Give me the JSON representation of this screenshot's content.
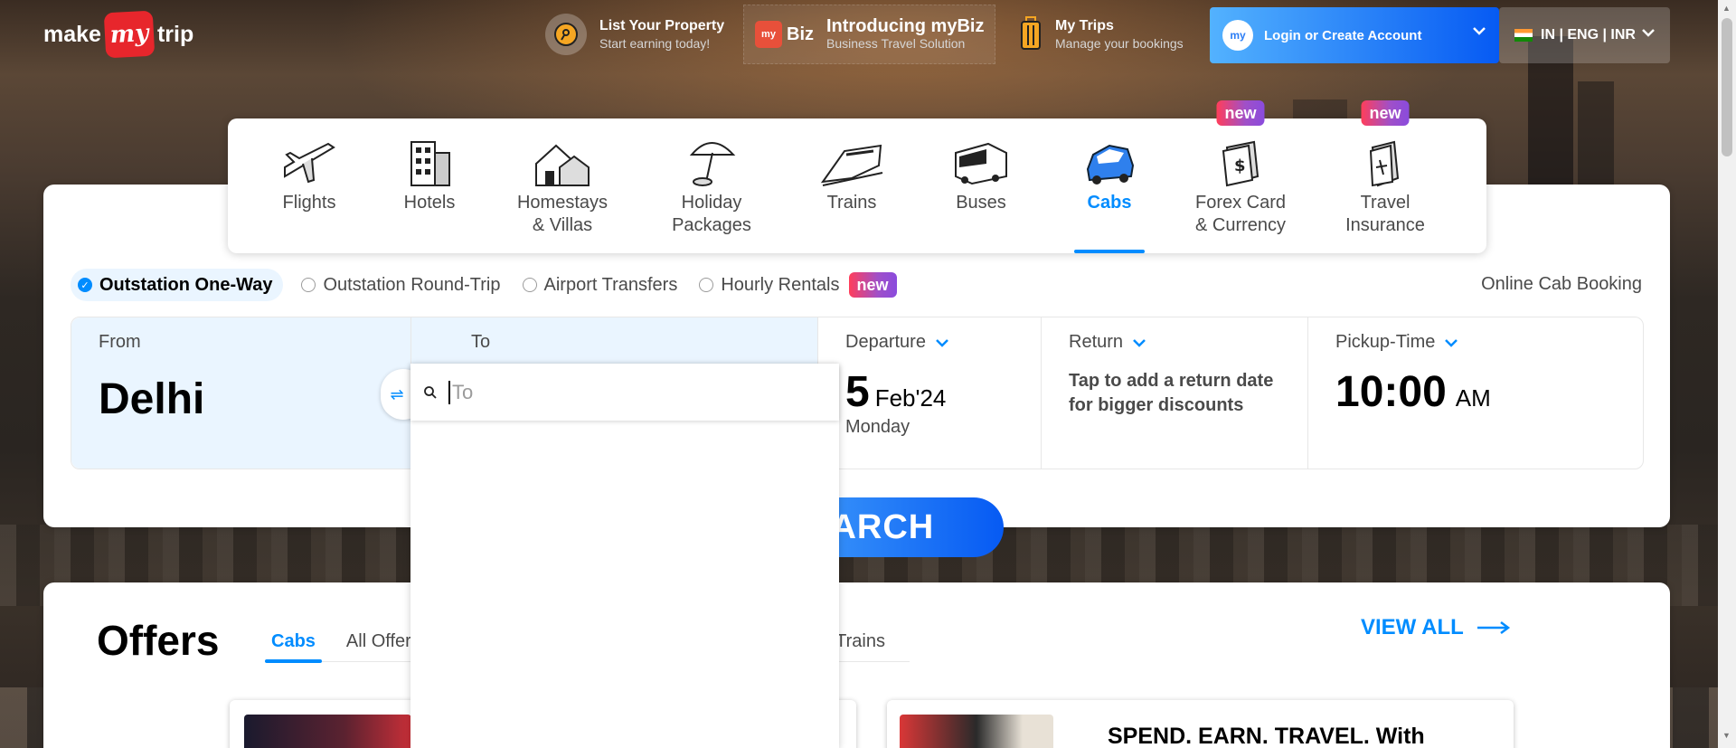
{
  "colors": {
    "accent": "#008cff",
    "brand_red": "#e7262c",
    "new_tag": "#a050c8"
  },
  "header": {
    "logo": {
      "left": "make",
      "mid": "my",
      "right": "trip"
    },
    "list_property": {
      "title": "List Your Property",
      "subtitle": "Start earning today!",
      "icon": "home-key-icon"
    },
    "mybiz": {
      "logo": "Biz",
      "title": "Introducing myBiz",
      "subtitle": "Business Travel Solution",
      "icon": "briefcase-icon"
    },
    "my_trips": {
      "title": "My Trips",
      "subtitle": "Manage your bookings",
      "icon": "suitcase-icon"
    },
    "login": {
      "label": "Login or Create Account",
      "avatar": "my"
    },
    "locale": {
      "label": "IN | ENG | INR"
    }
  },
  "nav": {
    "items": [
      {
        "label1": "Flights",
        "label2": "",
        "icon": "plane-icon",
        "new": false,
        "active": false
      },
      {
        "label1": "Hotels",
        "label2": "",
        "icon": "hotel-icon",
        "new": false,
        "active": false
      },
      {
        "label1": "Homestays",
        "label2": "& Villas",
        "icon": "homestay-icon",
        "new": false,
        "active": false
      },
      {
        "label1": "Holiday",
        "label2": "Packages",
        "icon": "umbrella-icon",
        "new": false,
        "active": false
      },
      {
        "label1": "Trains",
        "label2": "",
        "icon": "train-icon",
        "new": false,
        "active": false
      },
      {
        "label1": "Buses",
        "label2": "",
        "icon": "bus-icon",
        "new": false,
        "active": false
      },
      {
        "label1": "Cabs",
        "label2": "",
        "icon": "cab-icon",
        "new": false,
        "active": true
      },
      {
        "label1": "Forex Card",
        "label2": "& Currency",
        "icon": "forex-icon",
        "new": true,
        "active": false
      },
      {
        "label1": "Travel",
        "label2": "Insurance",
        "icon": "insurance-icon",
        "new": true,
        "active": false
      }
    ],
    "new_label": "new"
  },
  "trip_types": {
    "options": [
      "Outstation One-Way",
      "Outstation Round-Trip",
      "Airport Transfers",
      "Hourly Rentals"
    ],
    "selected": "Outstation One-Way",
    "new_badge": "new",
    "right_text": "Online Cab Booking"
  },
  "fields": {
    "from": {
      "label": "From",
      "value": "Delhi"
    },
    "to": {
      "label": "To"
    },
    "departure": {
      "label": "Departure",
      "day": "5",
      "month": "Feb'24",
      "weekday": "Monday"
    },
    "return": {
      "label": "Return",
      "hint_line1": "Tap to add a return date",
      "hint_line2": "for bigger discounts"
    },
    "pickup": {
      "label": "Pickup-Time",
      "time": "10:00",
      "ampm": "AM"
    }
  },
  "to_dropdown": {
    "placeholder": "To",
    "value": ""
  },
  "search_button": {
    "label": "SEARCH"
  },
  "offers": {
    "title": "Offers",
    "tabs": [
      "Cabs",
      "All Offers",
      "Trains"
    ],
    "active_tab": "Cabs",
    "view_all": "VIEW ALL",
    "card2_title": "SPEND. EARN. TRAVEL. With"
  }
}
